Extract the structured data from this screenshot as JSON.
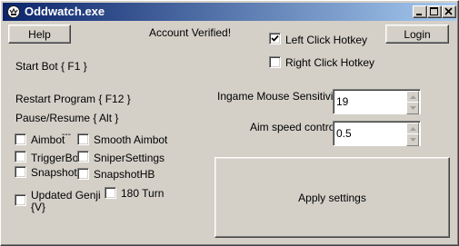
{
  "window": {
    "title": "Oddwatch.exe",
    "icon": "app-icon",
    "title_colors": {
      "start": "#0a246a",
      "end": "#a6caf0"
    },
    "caption_buttons": [
      "minimize-icon",
      "maximize-icon",
      "close-icon"
    ]
  },
  "buttons": {
    "help": "Help",
    "login": "Login",
    "apply": "Apply settings"
  },
  "status": {
    "account": "Account Verified!"
  },
  "hotkeys": {
    "left_click": {
      "label": "Left Click Hotkey",
      "checked": true
    },
    "right_click": {
      "label": "Right Click Hotkey",
      "checked": false
    }
  },
  "info": {
    "start_bot": "Start Bot { F1 }",
    "restart_program": "Restart Program { F12 }",
    "pause_resume": "Pause/Resume { Alt }"
  },
  "options": {
    "aimbot": {
      "label": "Aimbot",
      "suffix": "---",
      "checked": false
    },
    "smooth_aimbot": {
      "label": "Smooth Aimbot",
      "checked": false
    },
    "triggerbot": {
      "label": "TriggerBot",
      "checked": false
    },
    "sniper_settings": {
      "label": "SniperSettings",
      "checked": false
    },
    "snapshot": {
      "label": "Snapshot",
      "checked": false
    },
    "snapshot_hb": {
      "label": "SnapshotHB",
      "checked": false
    },
    "updated_genji": {
      "label_line1": "Updated Genji",
      "label_line2": "{V}",
      "checked": false
    },
    "turn_180": {
      "label": "180 Turn",
      "checked": false
    }
  },
  "settings": {
    "sensitivity": {
      "label": "Ingame Mouse Sensitivity",
      "value": "19"
    },
    "aim_speed": {
      "label": "Aim speed control",
      "value": "0.5"
    }
  }
}
